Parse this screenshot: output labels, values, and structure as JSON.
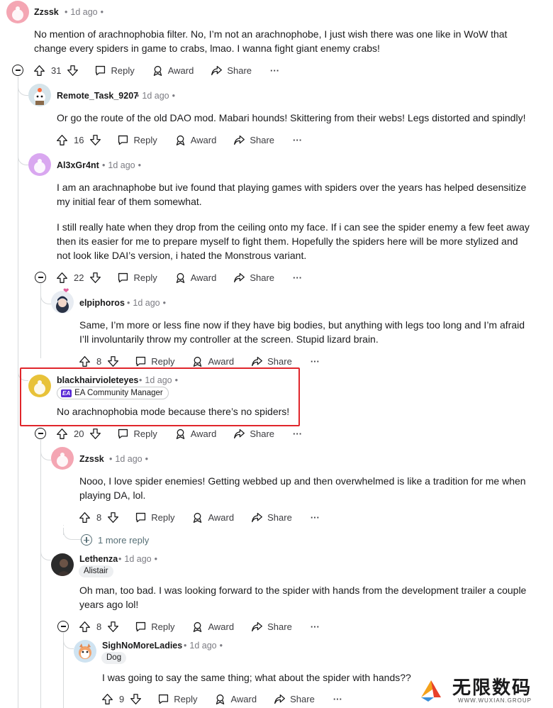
{
  "comments": [
    {
      "id": "c1",
      "username": "Zzssk",
      "time": "1d ago",
      "lines": [
        "No mention of arachnophobia filter. No, I’m not an arachnophobe, I just wish there was one like in WoW that",
        "change every spiders in game to crabs, lmao. I wanna fight giant enemy crabs!"
      ],
      "votes": "31"
    },
    {
      "id": "c2",
      "username": "Remote_Task_9207",
      "time": "1d ago",
      "lines": [
        "Or go the route of the old DAO mod. Mabari hounds! Skittering from their webs! Legs distorted and spindly!"
      ],
      "votes": "16"
    },
    {
      "id": "c3",
      "username": "Al3xGr4nt",
      "time": "1d ago",
      "lines": [
        "I am an arachnaphobe but ive found that playing games with spiders over the years has helped desensitize",
        "my initial fear of them somewhat."
      ],
      "lines2": [
        "I still really hate when they drop from the ceiling onto my face. If i can see the spider enemy a few feet away",
        "then its easier for me to prepare myself to fight them. Hopefully the spiders here will be more stylized and",
        "not look like DAI’s version, i hated the Monstrous variant."
      ],
      "votes": "22"
    },
    {
      "id": "c4",
      "username": "elpiphoros",
      "time": "1d ago",
      "lines": [
        "Same, I’m more or less fine now if they have big bodies, but anything with legs too long and I’m afraid",
        "I’ll involuntarily throw my controller at the screen. Stupid lizard brain."
      ],
      "votes": "8"
    },
    {
      "id": "c5",
      "username": "blackhairvioleteyes",
      "time": "1d ago",
      "flair": "EA Community Manager",
      "flair_logo": "EA",
      "lines": [
        "No arachnophobia mode because there’s no spiders!"
      ],
      "votes": "20"
    },
    {
      "id": "c6",
      "username": "Zzssk",
      "time": "1d ago",
      "lines": [
        "Nooo, I love spider enemies! Getting webbed up and then overwhelmed is like a tradition for me when",
        "playing DA, lol."
      ],
      "votes": "8",
      "more": "1 more reply"
    },
    {
      "id": "c7",
      "username": "Lethenza",
      "time": "1d ago",
      "flair": "Alistair",
      "lines": [
        "Oh man, too bad. I was looking forward to the spider with hands from the development trailer a couple",
        "years ago lol!"
      ],
      "votes": "8"
    },
    {
      "id": "c8",
      "username": "SighNoMoreLadies",
      "time": "1d ago",
      "flair": "Dog",
      "lines": [
        "I was going to say the same thing; what about the spider with hands??"
      ],
      "votes": "9"
    }
  ],
  "labels": {
    "reply": "Reply",
    "award": "Award",
    "share": "Share",
    "more": "···"
  },
  "watermark": {
    "text": "无限数码",
    "sub": "WWW.WUXIAN.GROUP"
  },
  "colors": {
    "highlight": "#e0262b",
    "thread_line": "#d7dadc",
    "flair_bg": "#edeff1"
  }
}
